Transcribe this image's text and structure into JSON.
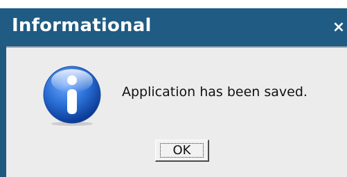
{
  "window": {
    "title": "Informational",
    "close_glyph": "×"
  },
  "dialog": {
    "icon": "info-icon",
    "message": "Application has been saved."
  },
  "buttons": {
    "ok_label": "OK"
  },
  "colors": {
    "titlebar": "#1f5b82",
    "body": "#ececec",
    "icon_blue": "#2a6fd6"
  }
}
